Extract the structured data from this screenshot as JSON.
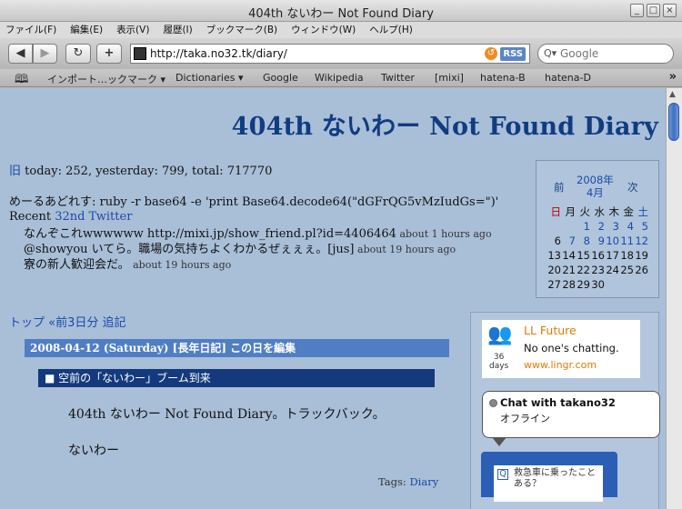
{
  "window": {
    "title": "404th ないわー Not Found Diary",
    "controls": [
      "_",
      "□",
      "×"
    ]
  },
  "menu": [
    "ファイル(F)",
    "編集(E)",
    "表示(V)",
    "履歴(I)",
    "ブックマーク(B)",
    "ウィンドウ(W)",
    "ヘルプ(H)"
  ],
  "toolbar": {
    "back": "◀",
    "forward": "▶",
    "reload": "↻",
    "add": "+",
    "url": "http://taka.no32.tk/diary/",
    "rss": "RSS",
    "search_placeholder": "Google",
    "search_glyph": "Q▾"
  },
  "bookmarks": {
    "book_glyph": "📖",
    "items": [
      "インポート…ックマーク ▾",
      "Dictionaries ▾",
      "Google",
      "Wikipedia",
      "Twitter",
      "[mixi]",
      "hatena-B",
      "hatena-D"
    ],
    "more": "»"
  },
  "blog": {
    "title": "404th ないわー Not Found Diary",
    "counter_old": "旧",
    "counter": " today: 252, yesterday: 799, total: 717770",
    "twitter_name": "めーるあどれす",
    "twitter_status": ": ruby -r base64 -e 'print Base64.decode64(\"dGFrQG5vMzIudGs=\")'",
    "recent_label": "Recent ",
    "recent_link": "32nd Twitter",
    "tweets": [
      {
        "text": "なんぞこれwwwwww http://mixi.jp/show_friend.pl?id=4406464",
        "time": " about 1 hours ago"
      },
      {
        "text": "@showyou いてら。職場の気持ちよくわかるぜぇぇぇ。[jus]",
        "time": " about 19 hours ago"
      },
      {
        "text": "寮の新人歓迎会だ。",
        "time": " about 19 hours ago"
      }
    ]
  },
  "calendar": {
    "prev": "前",
    "month_line1": "2008年",
    "month_line2": "4月",
    "next": "次",
    "dow": [
      "日",
      "月",
      "火",
      "水",
      "木",
      "金",
      "土"
    ],
    "rows": [
      [
        "",
        "",
        "1",
        "2",
        "3",
        "4",
        "5"
      ],
      [
        "6",
        "7",
        "8",
        "9",
        "10",
        "11",
        "12"
      ],
      [
        "13",
        "14",
        "15",
        "16",
        "17",
        "18",
        "19"
      ],
      [
        "20",
        "21",
        "22",
        "23",
        "24",
        "25",
        "26"
      ],
      [
        "27",
        "28",
        "29",
        "30",
        "",
        "",
        ""
      ]
    ],
    "linked_days": [
      "1",
      "2",
      "3",
      "4",
      "5",
      "7",
      "8",
      "9",
      "10",
      "11",
      "12"
    ]
  },
  "day": {
    "nav": "トップ «前3日分 追記",
    "header": "2008-04-12 (Saturday) [長年日記] この日を編集",
    "section": "■ 空前の「ないわー」ブーム到来",
    "line1": "404th ないわー Not Found Diary。トラックバック。",
    "line2": "ないわー",
    "tags_label": "Tags: ",
    "tags_link": "Diary"
  },
  "lingr": {
    "name": "LL Future",
    "status": "No one's chatting.",
    "url": "www.lingr.com",
    "days_num": "36",
    "days_label": "days"
  },
  "chat": {
    "title": "Chat with takano32",
    "status": "オフライン"
  },
  "qbox": {
    "text": "救急車に乗ったことある？"
  },
  "colors": {
    "page_bg": "#a9bfd8",
    "title": "#103c80",
    "day_bar": "#4f7ec4",
    "section_bar": "#143a7d",
    "link": "#1a4aa8",
    "lingr_orange": "#e17a00"
  }
}
